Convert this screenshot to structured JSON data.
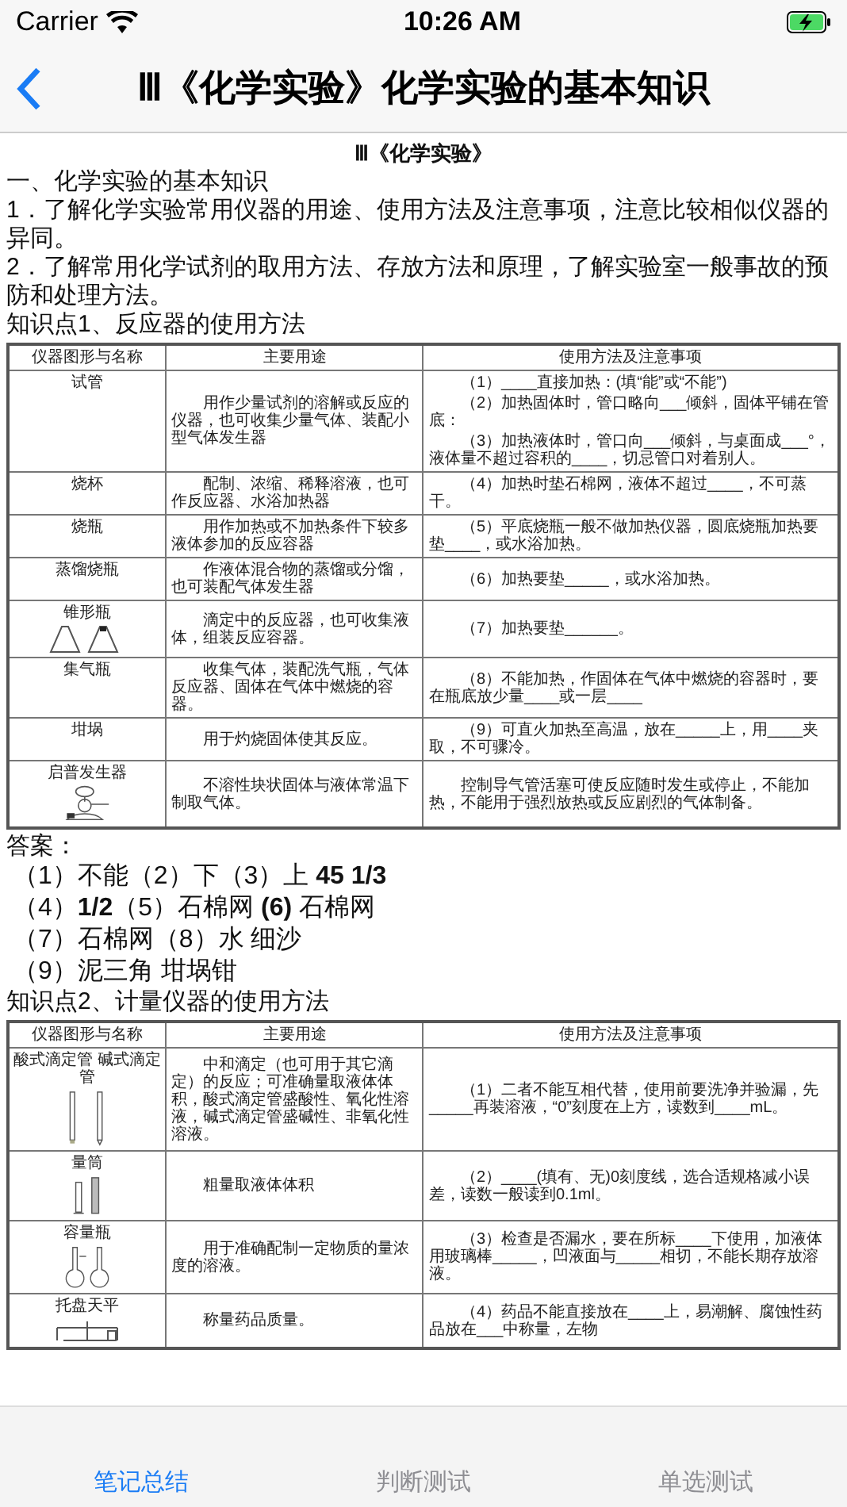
{
  "status_bar": {
    "carrier": "Carrier",
    "time": "10:26 AM",
    "charging": true
  },
  "nav": {
    "title": "Ⅲ《化学实验》化学实验的基本知识"
  },
  "doc": {
    "subtitle": "Ⅲ《化学实验》",
    "blocks": [
      {
        "kind": "paragraph",
        "text": "一、化学实验的基本知识"
      },
      {
        "kind": "paragraph",
        "text": "1．了解化学实验常用仪器的用途、使用方法及注意事项，注意比较相似仪器的异同。"
      },
      {
        "kind": "paragraph",
        "text": "2．了解常用化学试剂的取用方法、存放方法和原理，了解实验室一般事故的预防和处理方法。"
      },
      {
        "kind": "paragraph",
        "text": "知识点1、反应器的使用方法"
      },
      {
        "kind": "table",
        "columns": [
          "仪器图形与名称",
          "主要用途",
          "使用方法及注意事项"
        ],
        "rows": [
          {
            "name": "试管",
            "use": "用作少量试剂的溶解或反应的仪器，也可收集少量气体、装配小型气体发生器",
            "notes": [
              "（1）____直接加热：(填“能”或“不能”)",
              "（2）加热固体时，管口略向___倾斜，固体平铺在管底：",
              "（3）加热液体时，管口向___倾斜，与桌面成___°，液体量不超过容积的____，切忌管口对着别人。"
            ]
          },
          {
            "name": "烧杯",
            "use": "配制、浓缩、稀释溶液，也可作反应器、水浴加热器",
            "notes": [
              "（4）加热时垫石棉网，液体不超过____，不可蒸干。"
            ]
          },
          {
            "name": "烧瓶",
            "use": "用作加热或不加热条件下较多液体参加的反应容器",
            "notes": [
              "（5）平底烧瓶一般不做加热仪器，圆底烧瓶加热要垫____，或水浴加热。"
            ]
          },
          {
            "name": "蒸馏烧瓶",
            "use": "作液体混合物的蒸馏或分馏，也可装配气体发生器",
            "notes": [
              "（6）加热要垫_____，或水浴加热。"
            ]
          },
          {
            "name": "锥形瓶",
            "kind": "flasks",
            "use": "滴定中的反应器，也可收集液体，组装反应容器。",
            "notes": [
              "（7）加热要垫______。"
            ]
          },
          {
            "name": "集气瓶",
            "use": "收集气体，装配洗气瓶，气体反应器、固体在气体中燃烧的容器。",
            "notes": [
              "（8）不能加热，作固体在气体中燃烧的容器时，要在瓶底放少量____或一层____"
            ]
          },
          {
            "name": "坩埚",
            "use": "用于灼烧固体使其反应。",
            "notes": [
              "（9）可直火加热至高温，放在_____上，用____夹取，不可骤冷。"
            ]
          },
          {
            "name": "启普发生器",
            "kind": "kipp",
            "use": "不溶性块状固体与液体常温下制取气体。",
            "notes": [
              "控制导气管活塞可使反应随时发生或停止，不能加热，不能用于强烈放热或反应剧烈的气体制备。"
            ]
          }
        ]
      },
      {
        "kind": "paragraph",
        "text": "答案："
      },
      {
        "kind": "answer",
        "text": "（1）不能（2）下（3）上 **45 1/3**"
      },
      {
        "kind": "answer",
        "text": "（4）**1/2**（5）石棉网 **(6)** 石棉网"
      },
      {
        "kind": "answer",
        "text": "（7）石棉网（8）水 细沙"
      },
      {
        "kind": "answer",
        "text": "（9）泥三角 坩埚钳"
      },
      {
        "kind": "paragraph",
        "text": "知识点2、计量仪器的使用方法"
      },
      {
        "kind": "table",
        "columns": [
          "仪器图形与名称",
          "主要用途",
          "使用方法及注意事项"
        ],
        "rows": [
          {
            "name": "酸式滴定管 碱式滴定管",
            "kind": "burettes",
            "use": "中和滴定（也可用于其它滴定）的反应；可准确量取液体体积，酸式滴定管盛酸性、氧化性溶液，碱式滴定管盛碱性、非氧化性溶液。",
            "notes": [
              "（1）二者不能互相代替，使用前要洗净并验漏，先_____再装溶液，“0”刻度在上方，读数到____mL。"
            ]
          },
          {
            "name": "量筒",
            "kind": "cylinders",
            "use": "粗量取液体体积",
            "notes": [
              "（2）____(填有、无)0刻度线，选合适规格减小误差，读数一般读到0.1ml。"
            ]
          },
          {
            "name": "容量瓶",
            "kind": "volumetric",
            "use": "用于准确配制一定物质的量浓度的溶液。",
            "notes": [
              "（3）检查是否漏水，要在所标____下使用，加液体用玻璃棒_____，凹液面与_____相切，不能长期存放溶液。"
            ]
          },
          {
            "name": "托盘天平",
            "kind": "balance",
            "use": "称量药品质量。",
            "notes": [
              "（4）药品不能直接放在____上，易潮解、腐蚀性药品放在___中称量，左物"
            ]
          }
        ]
      }
    ]
  },
  "tabs": [
    {
      "label": "笔记总结",
      "selected": true
    },
    {
      "label": "判断测试",
      "selected": false
    },
    {
      "label": "单选测试",
      "selected": false
    }
  ]
}
